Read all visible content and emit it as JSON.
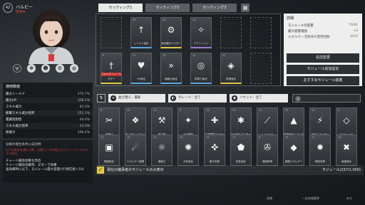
{
  "character": {
    "level": "42",
    "name": "バルビー",
    "status": "使用中",
    "icons": [
      "shield-icon",
      "crosshair-icon",
      "person-icon",
      "gear-icon",
      "globe-icon"
    ]
  },
  "stats": {
    "title": "適用数値",
    "rows": [
      {
        "label": "最大シールド",
        "value": "275.7%"
      },
      {
        "label": "最大HP",
        "value": "358.5%"
      },
      {
        "label": "スキル威力",
        "value": "81.0%"
      },
      {
        "label": "斬撃スキル威力倍率",
        "value": "251.1%"
      },
      {
        "label": "電属性耐性",
        "value": "40.0%"
      },
      {
        "label": "スキル威力倍率",
        "value": "54.0%"
      },
      {
        "label": "防御力",
        "value": "208.4%"
      }
    ]
  },
  "description": {
    "title": "効果の発生条件に成功時",
    "sub": "以下の条件を満たす時、以降ビーグを満たすとチャージングスキルで変化。",
    "body": "チャージ補助攻撃を改造\nチャージ補助攻撃時、ダガーで攻撃\n強攻撃時に以下、モジュール最大容量(が)現在値＋10)"
  },
  "tabs": [
    "セッティング1",
    "セッティング2",
    "セッティング3"
  ],
  "info_panel": {
    "title": "詳細",
    "capacity_label": "モジュールの容量",
    "capacity_value": "73/81",
    "max_label": "最大容量増加",
    "max_value": "+3",
    "energy_label": "エネルギー活性体の使用回数",
    "energy_value": "(0/3)",
    "buttons": [
      "名前変更",
      "モジュール追加設定",
      "おすすめモジュール装着"
    ]
  },
  "equipped": [
    {
      "name": "",
      "empty": true,
      "icon": "",
      "cost": ""
    },
    {
      "name": "シールド強化",
      "icon": "↑",
      "cost": "12",
      "color": "blue"
    },
    {
      "name": "強化集約マスター",
      "icon": "⚙",
      "cost": "15",
      "color": "yellow"
    },
    {
      "name": "テクニシャン",
      "icon": "✧",
      "cost": "10",
      "color": "purple"
    },
    {
      "name": "",
      "empty": true,
      "icon": "",
      "cost": ""
    },
    {
      "name": "",
      "empty": true,
      "icon": "",
      "cost": ""
    },
    {
      "name": "ダガー",
      "icon": "†",
      "cost": "9",
      "color": "yellow",
      "badge": "スキルモジュール"
    },
    {
      "name": "HP強化",
      "icon": "♥",
      "cost": "11",
      "color": "blue"
    },
    {
      "name": "機敏な強化",
      "icon": "»",
      "cost": "10",
      "color": "blue"
    },
    {
      "name": "照準力強化",
      "icon": "◎",
      "cost": "12",
      "color": "blue"
    },
    {
      "name": "防御強化",
      "icon": "◈",
      "cost": "12",
      "color": "yellow"
    },
    {
      "name": "",
      "empty": true,
      "icon": "",
      "cost": ""
    }
  ],
  "filters": {
    "sort": "並び替え：最新",
    "grade": "グレード：全て",
    "socket": "ソケット：全て"
  },
  "inventory": [
    {
      "name": "全選び",
      "icon": "✂",
      "cost": "8"
    },
    {
      "name": "タイタス・ウォード",
      "icon": "❖",
      "cost": "10"
    },
    {
      "name": "重力崩",
      "icon": "⚒",
      "cost": "12"
    },
    {
      "name": "炎分離形",
      "icon": "✦",
      "cost": "9"
    },
    {
      "name": "工学専門マスター",
      "icon": "✚",
      "cost": "14"
    },
    {
      "name": "巨大破片マスター",
      "icon": "✱",
      "cost": "13"
    },
    {
      "name": "トンファー",
      "icon": "⟋",
      "cost": "11"
    },
    {
      "name": "性能強化エネルギー",
      "icon": "▲",
      "cost": "15"
    },
    {
      "name": "強化エネルギー",
      "icon": "⚡",
      "cost": "10"
    },
    {
      "name": "クリティカル",
      "icon": "◇",
      "cost": "9"
    },
    {
      "name": "範囲強化",
      "icon": "▣",
      "cost": "12"
    },
    {
      "name": "エネルギー循環",
      "icon": "☄",
      "cost": "14"
    },
    {
      "name": "増幅力",
      "icon": "☼",
      "cost": "11"
    },
    {
      "name": "冷気強化",
      "icon": "✺",
      "cost": "10"
    },
    {
      "name": "集中攻撃",
      "icon": "✜",
      "cost": "12"
    },
    {
      "name": "耐性強化",
      "icon": "⬟",
      "cost": "13"
    },
    {
      "name": "連続射撃",
      "icon": "✇",
      "cost": "9"
    },
    {
      "name": "強靭エネルギー",
      "icon": "◆",
      "cost": "15"
    },
    {
      "name": "精密攻撃",
      "icon": "✹",
      "cost": "11"
    },
    {
      "name": "破壊強化",
      "icon": "✖",
      "cost": "10"
    }
  ],
  "footer": {
    "only_label": "現在の継承者のモジュールのみ表示",
    "module_count": "モジュール(237/1,000)"
  },
  "hints": {
    "detail": "詳細",
    "equip_all": "一括装着解除",
    "back": "戻る"
  }
}
